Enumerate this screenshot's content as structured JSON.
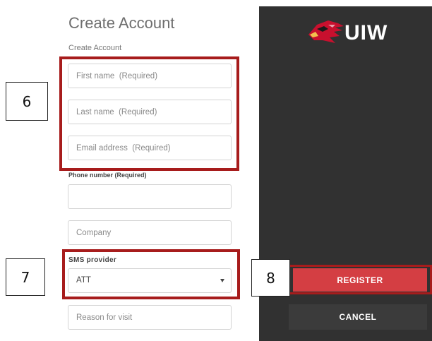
{
  "form": {
    "title": "Create Account",
    "subtitle": "Create Account",
    "first_name_placeholder": "First name  (Required)",
    "last_name_placeholder": "Last name  (Required)",
    "email_placeholder": "Email address  (Required)",
    "phone_label": "Phone number (Required)",
    "phone_value": "",
    "company_placeholder": "Company",
    "sms_label": "SMS provider",
    "sms_selected": "ATT",
    "reason_placeholder": "Reason for visit"
  },
  "brand": {
    "logo_text": "UIW",
    "logo_icon": "cardinal-head-icon",
    "red": "#c8102e",
    "panel_color": "#313131"
  },
  "actions": {
    "register_label": "REGISTER",
    "cancel_label": "CANCEL",
    "register_color": "#d43e43"
  },
  "callouts": {
    "six": "6",
    "seven": "7",
    "eight": "8",
    "highlight_color": "#a71c1c"
  }
}
